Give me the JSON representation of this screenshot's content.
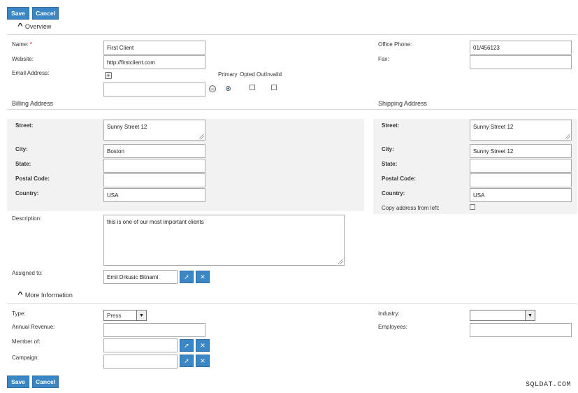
{
  "toolbar": {
    "save_label": "Save",
    "cancel_label": "Cancel"
  },
  "overview": {
    "title": "Overview",
    "name_label": "Name:",
    "required_mark": "*",
    "name_value": "First Client",
    "website_label": "Website:",
    "website_value": "http://firstclient.com",
    "email_label": "Email Address:",
    "email_value": "",
    "email_columns": {
      "primary": "Primary",
      "opted_out": "Opted Out",
      "invalid": "Invalid"
    },
    "office_phone_label": "Office Phone:",
    "office_phone_value": "01/456123",
    "fax_label": "Fax:",
    "fax_value": ""
  },
  "billing": {
    "title": "Billing Address",
    "street_label": "Street:",
    "street_value": "Sunny Street 12",
    "city_label": "City:",
    "city_value": "Boston",
    "state_label": "State:",
    "state_value": "",
    "postal_label": "Postal Code:",
    "postal_value": "",
    "country_label": "Country:",
    "country_value": "USA"
  },
  "shipping": {
    "title": "Shipping Address",
    "street_label": "Street:",
    "street_value": "Sunny Street 12",
    "city_label": "City:",
    "city_value": "Sunny Street 12",
    "state_label": "State:",
    "state_value": "",
    "postal_label": "Postal Code:",
    "postal_value": "",
    "country_label": "Country:",
    "country_value": "USA",
    "copy_label": "Copy address from left:"
  },
  "description": {
    "label": "Description:",
    "value": "this is one of our most important clients"
  },
  "assigned": {
    "label": "Assigned to:",
    "value": "Emil Drkusic Bitnami"
  },
  "more_info": {
    "title": "More Information",
    "type_label": "Type:",
    "type_value": "Press",
    "revenue_label": "Annual Revenue:",
    "revenue_value": "",
    "member_label": "Member of:",
    "member_value": "",
    "campaign_label": "Campaign:",
    "campaign_value": "",
    "industry_label": "Industry:",
    "industry_value": "",
    "employees_label": "Employees:",
    "employees_value": ""
  },
  "icons": {
    "select": "select-arrow-icon",
    "clear": "clear-icon",
    "add": "plus-icon",
    "remove": "minus-icon",
    "collapse": "chevron-up-icon",
    "dropdown": "triangle-down-icon"
  },
  "colors": {
    "button": "#3b86c4",
    "panel": "#f2f2f2"
  },
  "watermark": "SQLDAT.COM"
}
